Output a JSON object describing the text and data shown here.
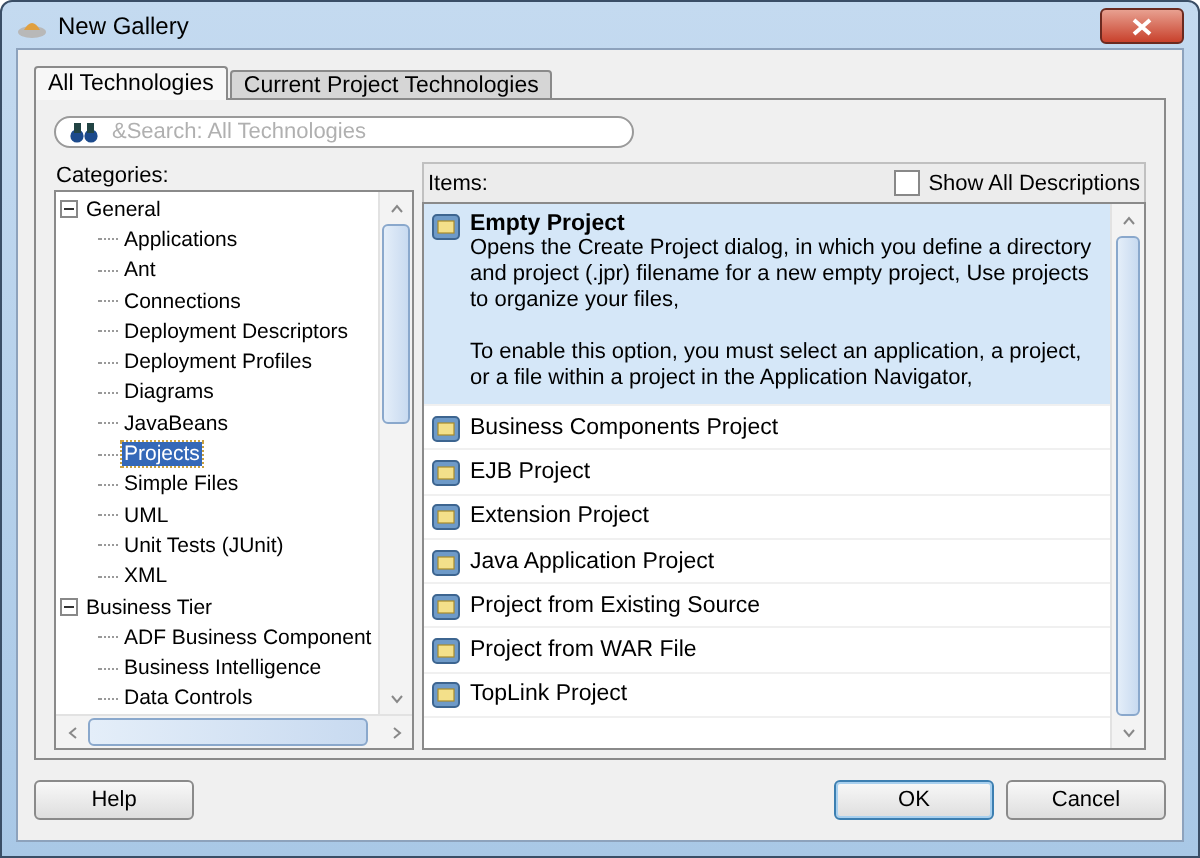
{
  "window": {
    "title": "New Gallery"
  },
  "tabs": [
    {
      "label": "All Technologies",
      "selected": true
    },
    {
      "label": "Current Project Technologies",
      "selected": false
    }
  ],
  "search": {
    "placeholder": "&Search: All Technologies"
  },
  "categories": {
    "label": "Categories:",
    "tree": [
      {
        "label": "General",
        "expanded": true,
        "selected": false,
        "children": [
          {
            "label": "Applications",
            "selected": false
          },
          {
            "label": "Ant",
            "selected": false
          },
          {
            "label": "Connections",
            "selected": false
          },
          {
            "label": "Deployment Descriptors",
            "selected": false
          },
          {
            "label": "Deployment Profiles",
            "selected": false
          },
          {
            "label": "Diagrams",
            "selected": false
          },
          {
            "label": "JavaBeans",
            "selected": false
          },
          {
            "label": "Projects",
            "selected": true
          },
          {
            "label": "Simple Files",
            "selected": false
          },
          {
            "label": "UML",
            "selected": false
          },
          {
            "label": "Unit Tests (JUnit)",
            "selected": false
          },
          {
            "label": "XML",
            "selected": false
          }
        ]
      },
      {
        "label": "Business Tier",
        "expanded": true,
        "selected": false,
        "children": [
          {
            "label": "ADF Business Component",
            "selected": false
          },
          {
            "label": "Business Intelligence",
            "selected": false
          },
          {
            "label": "Data Controls",
            "selected": false
          }
        ]
      }
    ]
  },
  "items": {
    "label": "Items:",
    "show_all_descriptions": {
      "label": "Show All Descriptions",
      "checked": false
    },
    "list": [
      {
        "label": "Empty Project",
        "selected": true,
        "description": [
          "Opens the Create Project dialog, in which you define a directory and project (.jpr) filename for a new empty project, Use projects to organize your files,",
          "To enable this option, you must select an application, a project, or a file within a project in the Application Navigator,"
        ]
      },
      {
        "label": "Business Components Project",
        "selected": false
      },
      {
        "label": "EJB Project",
        "selected": false
      },
      {
        "label": "Extension Project",
        "selected": false
      },
      {
        "label": "Java Application Project",
        "selected": false
      },
      {
        "label": "Project from Existing Source",
        "selected": false
      },
      {
        "label": "Project from WAR File",
        "selected": false
      },
      {
        "label": "TopLink Project",
        "selected": false
      }
    ]
  },
  "buttons": {
    "help": "Help",
    "ok": "OK",
    "cancel": "Cancel"
  }
}
